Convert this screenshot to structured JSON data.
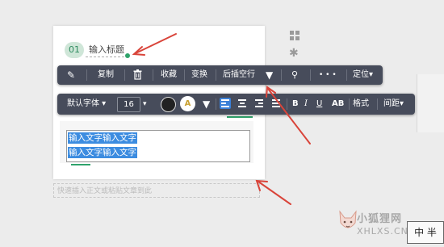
{
  "editor": {
    "number": "01",
    "title": "输入标题",
    "text_line1": "输入文字输入文字",
    "text_line2": "输入文字输入文字",
    "placeholder": "快速插入正文或粘贴文章到此"
  },
  "toolbar1": {
    "copy": "复制",
    "collect": "收藏",
    "transform": "变换",
    "insert_blank_line": "后插空行",
    "more": "• • •",
    "position": "定位▾"
  },
  "toolbar2": {
    "default_font": "默认字体 ▾",
    "font_size": "16",
    "font_size_arrow": "▾",
    "bg_color_letter": "A",
    "bold": "B",
    "italic": "I",
    "underline": "U",
    "strike": "AB",
    "format": "格式",
    "spacing": "间距▾"
  },
  "watermark": {
    "brand": "小狐狸网",
    "url": "XHLXS.CN"
  },
  "lang_badge": "中 半",
  "colors": {
    "toolbar_bg": "#474c5b",
    "accent_green": "#2fa36b",
    "selection_blue": "#3c8ce0",
    "arrow_red": "#d9443a"
  },
  "icons": {
    "pin": "pin-icon",
    "trash": "trash-icon",
    "triangle": "dropdown-triangle-icon",
    "wand": "magic-icon",
    "grid": "grid-icon",
    "gear": "gear-icon"
  }
}
